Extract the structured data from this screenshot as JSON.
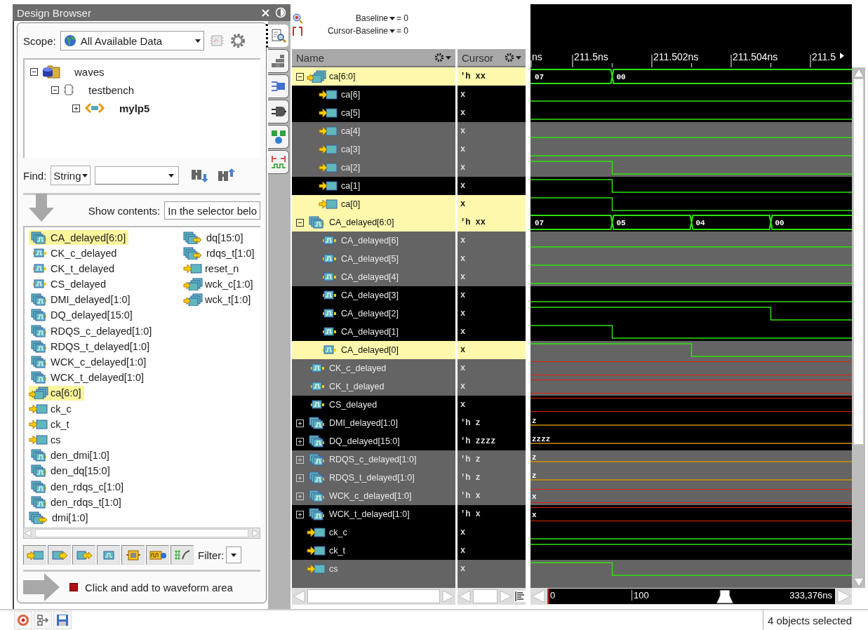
{
  "design_browser": {
    "title": "Design Browser",
    "scope": {
      "label": "Scope:",
      "value": "All Available Data"
    },
    "tree": [
      {
        "label": "waves",
        "kind": "database",
        "expanded": true,
        "children": [
          {
            "label": "testbench",
            "kind": "module",
            "expanded": true,
            "children": [
              {
                "label": "mylp5",
                "kind": "instance",
                "expanded": false
              }
            ]
          }
        ]
      }
    ],
    "side_tabs": [
      {
        "selected": true
      },
      {
        "selected": false
      },
      {
        "selected": false
      },
      {
        "selected": false
      },
      {
        "selected": false
      },
      {
        "selected": false
      }
    ],
    "find": {
      "label": "Find:",
      "type": "String"
    },
    "show_contents": {
      "label": "Show contents:",
      "value": "In the selector belo"
    },
    "signals": [
      {
        "label": "CA_delayed[6:0]",
        "kind": "signal_bus",
        "selected": true
      },
      {
        "label": "CK_c_delayed",
        "kind": "signal",
        "selected": false
      },
      {
        "label": "CK_t_delayed",
        "kind": "signal",
        "selected": false
      },
      {
        "label": "CS_delayed",
        "kind": "signal",
        "selected": false
      },
      {
        "label": "DMI_delayed[1:0]",
        "kind": "signal_bus",
        "selected": false
      },
      {
        "label": "DQ_delayed[15:0]",
        "kind": "signal_bus",
        "selected": false
      },
      {
        "label": "RDQS_c_delayed[1:0]",
        "kind": "signal_bus",
        "selected": false
      },
      {
        "label": "RDQS_t_delayed[1:0]",
        "kind": "signal_bus",
        "selected": false
      },
      {
        "label": "WCK_c_delayed[1:0]",
        "kind": "signal_bus",
        "selected": false
      },
      {
        "label": "WCK_t_delayed[1:0]",
        "kind": "signal_bus",
        "selected": false
      },
      {
        "label": "ca[6:0]",
        "kind": "port_bus",
        "selected": true
      },
      {
        "label": "ck_c",
        "kind": "port",
        "selected": false
      },
      {
        "label": "ck_t",
        "kind": "port",
        "selected": false
      },
      {
        "label": "cs",
        "kind": "port",
        "selected": false
      },
      {
        "label": "den_dmi[1:0]",
        "kind": "signal_bus",
        "selected": false
      },
      {
        "label": "den_dq[15:0]",
        "kind": "signal_bus",
        "selected": false
      },
      {
        "label": "den_rdqs_c[1:0]",
        "kind": "signal_bus",
        "selected": false
      },
      {
        "label": "den_rdqs_t[1:0]",
        "kind": "signal_bus",
        "selected": false
      },
      {
        "label": "dmi[1:0]",
        "kind": "inout_bus",
        "selected": false
      },
      {
        "label": "dq[15:0]",
        "kind": "inout_bus",
        "selected": false
      },
      {
        "label": "rdqs_t[1:0]",
        "kind": "inout_bus",
        "selected": false
      },
      {
        "label": "reset_n",
        "kind": "port",
        "selected": false
      },
      {
        "label": "wck_c[1:0]",
        "kind": "port_bus",
        "selected": false
      },
      {
        "label": "wck_t[1:0]",
        "kind": "port_bus",
        "selected": false
      }
    ],
    "filters": [
      {
        "on": true
      },
      {
        "on": true
      },
      {
        "on": true
      },
      {
        "on": true
      },
      {
        "on": true
      },
      {
        "on": true
      },
      {
        "on": true
      }
    ],
    "filter_label": "Filter:",
    "hint": "Click and add to waveform area"
  },
  "waveform": {
    "baseline": {
      "label": "Baseline",
      "value": "= 0"
    },
    "cursor_baseline": {
      "label": "Cursor-Baseline",
      "value": "= 0"
    },
    "columns": {
      "name": "Name",
      "cursor": "Cursor"
    },
    "ruler": [
      "ns",
      "211.5ns",
      "211.502ns",
      "211.504ns",
      "211.5"
    ],
    "rows": [
      {
        "name": "ca[6:0]",
        "value": "'h xx",
        "kind": "port_bus",
        "selected": true,
        "expanded": true,
        "wave": {
          "kind": "bus",
          "segments": [
            "07",
            "00"
          ]
        },
        "children": [
          {
            "name": "ca[6]",
            "value": "x",
            "kind": "port",
            "selected": false,
            "wave": {
              "kind": "low"
            }
          },
          {
            "name": "ca[5]",
            "value": "x",
            "kind": "port",
            "selected": false,
            "wave": {
              "kind": "low"
            }
          },
          {
            "name": "ca[4]",
            "value": "x",
            "kind": "port",
            "selected": false,
            "wave": {
              "kind": "low"
            }
          },
          {
            "name": "ca[3]",
            "value": "x",
            "kind": "port",
            "selected": false,
            "wave": {
              "kind": "low"
            }
          },
          {
            "name": "ca[2]",
            "value": "x",
            "kind": "port",
            "selected": false,
            "wave": {
              "kind": "fall"
            }
          },
          {
            "name": "ca[1]",
            "value": "x",
            "kind": "port",
            "selected": false,
            "wave": {
              "kind": "fall"
            }
          },
          {
            "name": "ca[0]",
            "value": "x",
            "kind": "port",
            "selected": true,
            "wave": {
              "kind": "fall"
            }
          }
        ]
      },
      {
        "name": "CA_delayed[6:0]",
        "value": "'h xx",
        "kind": "signal_bus",
        "selected": true,
        "expanded": true,
        "wave": {
          "kind": "bus",
          "segments": [
            "07",
            "05",
            "04",
            "00"
          ]
        },
        "children": [
          {
            "name": "CA_delayed[6]",
            "value": "x",
            "kind": "signal",
            "selected": false,
            "wave": {
              "kind": "low"
            }
          },
          {
            "name": "CA_delayed[5]",
            "value": "x",
            "kind": "signal",
            "selected": false,
            "wave": {
              "kind": "low"
            }
          },
          {
            "name": "CA_delayed[4]",
            "value": "x",
            "kind": "signal",
            "selected": false,
            "wave": {
              "kind": "low"
            }
          },
          {
            "name": "CA_delayed[3]",
            "value": "x",
            "kind": "signal",
            "selected": false,
            "wave": {
              "kind": "low"
            }
          },
          {
            "name": "CA_delayed[2]",
            "value": "x",
            "kind": "signal",
            "selected": false,
            "wave": {
              "kind": "fall"
            }
          },
          {
            "name": "CA_delayed[1]",
            "value": "x",
            "kind": "signal",
            "selected": false,
            "wave": {
              "kind": "fall"
            }
          },
          {
            "name": "CA_delayed[0]",
            "value": "x",
            "kind": "signal",
            "selected": true,
            "wave": {
              "kind": "fall"
            }
          }
        ]
      },
      {
        "name": "CK_c_delayed",
        "value": "x",
        "kind": "signal",
        "selected": false,
        "wave": {
          "kind": "x"
        }
      },
      {
        "name": "CK_t_delayed",
        "value": "x",
        "kind": "signal",
        "selected": false,
        "wave": {
          "kind": "x"
        }
      },
      {
        "name": "CS_delayed",
        "value": "x",
        "kind": "signal",
        "selected": false,
        "wave": {
          "kind": "x"
        }
      },
      {
        "name": "DMI_delayed[1:0]",
        "value": "'h z",
        "kind": "signal_bus",
        "selected": false,
        "expanded": false,
        "wave": {
          "kind": "z",
          "label": "z"
        }
      },
      {
        "name": "DQ_delayed[15:0]",
        "value": "'h zzzz",
        "kind": "signal_bus",
        "selected": false,
        "expanded": false,
        "wave": {
          "kind": "z",
          "label": "zzzz"
        }
      },
      {
        "name": "RDQS_c_delayed[1:0]",
        "value": "'h z",
        "kind": "signal_bus",
        "selected": false,
        "expanded": false,
        "wave": {
          "kind": "z",
          "label": "z"
        }
      },
      {
        "name": "RDQS_t_delayed[1:0]",
        "value": "'h z",
        "kind": "signal_bus",
        "selected": false,
        "expanded": false,
        "wave": {
          "kind": "z",
          "label": "z"
        }
      },
      {
        "name": "WCK_c_delayed[1:0]",
        "value": "'h x",
        "kind": "signal_bus",
        "selected": false,
        "expanded": false,
        "wave": {
          "kind": "x",
          "label": "x"
        }
      },
      {
        "name": "WCK_t_delayed[1:0]",
        "value": "'h x",
        "kind": "signal_bus",
        "selected": false,
        "expanded": false,
        "wave": {
          "kind": "x",
          "label": "x"
        }
      },
      {
        "name": "ck_c",
        "value": "x",
        "kind": "port",
        "selected": false,
        "wave": {
          "kind": "low"
        }
      },
      {
        "name": "ck_t",
        "value": "x",
        "kind": "port",
        "selected": false,
        "wave": {
          "kind": "high"
        }
      },
      {
        "name": "cs",
        "value": "x",
        "kind": "port",
        "selected": false,
        "wave": {
          "kind": "fall"
        }
      }
    ],
    "timeline": {
      "ticks": [
        "0",
        "100"
      ],
      "end": "333,376ns"
    }
  },
  "status_bar": {
    "message": "4 objects selected"
  }
}
